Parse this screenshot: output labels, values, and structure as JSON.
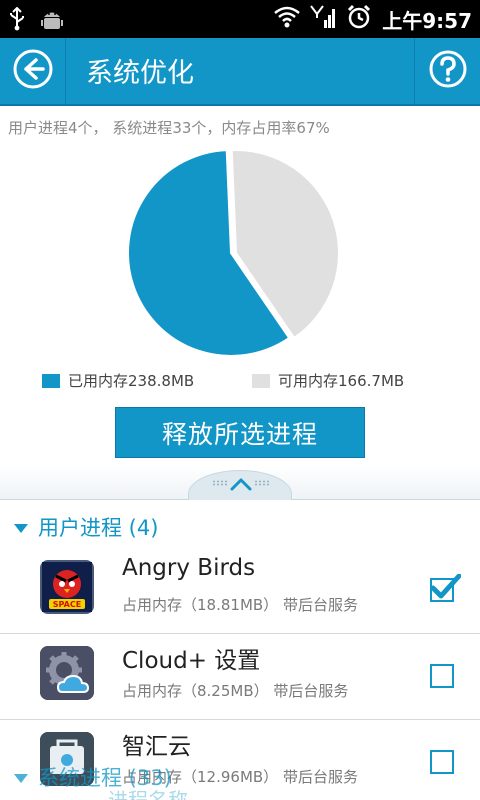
{
  "status_bar": {
    "time": "上午9:57"
  },
  "header": {
    "title": "系统优化"
  },
  "summary": {
    "text": "用户进程4个， 系统进程33个，内存占用率67%"
  },
  "chart_data": {
    "type": "pie",
    "slices": [
      {
        "name": "已用内存238.8MB",
        "value": 238.8,
        "color": "#1296c8"
      },
      {
        "name": "可用内存166.7MB",
        "value": 166.7,
        "color": "#e0e0e0"
      }
    ]
  },
  "legend": {
    "used": "已用内存238.8MB",
    "free": "可用内存166.7MB"
  },
  "release_button": {
    "label": "释放所选进程"
  },
  "user_group": {
    "label": "用户进程 (4)"
  },
  "apps": [
    {
      "name": "Angry Birds",
      "sub": "占用内存（18.81MB） 带后台服务",
      "checked": true,
      "icon": "angry-birds-icon"
    },
    {
      "name": "Cloud+ 设置",
      "sub": "占用内存（8.25MB） 带后台服务",
      "checked": false,
      "icon": "cloud-settings-icon"
    },
    {
      "name": "智汇云",
      "sub": "占用内存（12.96MB） 带后台服务",
      "checked": false,
      "icon": "zhihuiyun-icon"
    }
  ],
  "system_group": {
    "label": "系统进程 (33)"
  },
  "ghost_column": {
    "label": "进程名称"
  },
  "colors": {
    "accent": "#1296c8",
    "free": "#e0e0e0"
  }
}
